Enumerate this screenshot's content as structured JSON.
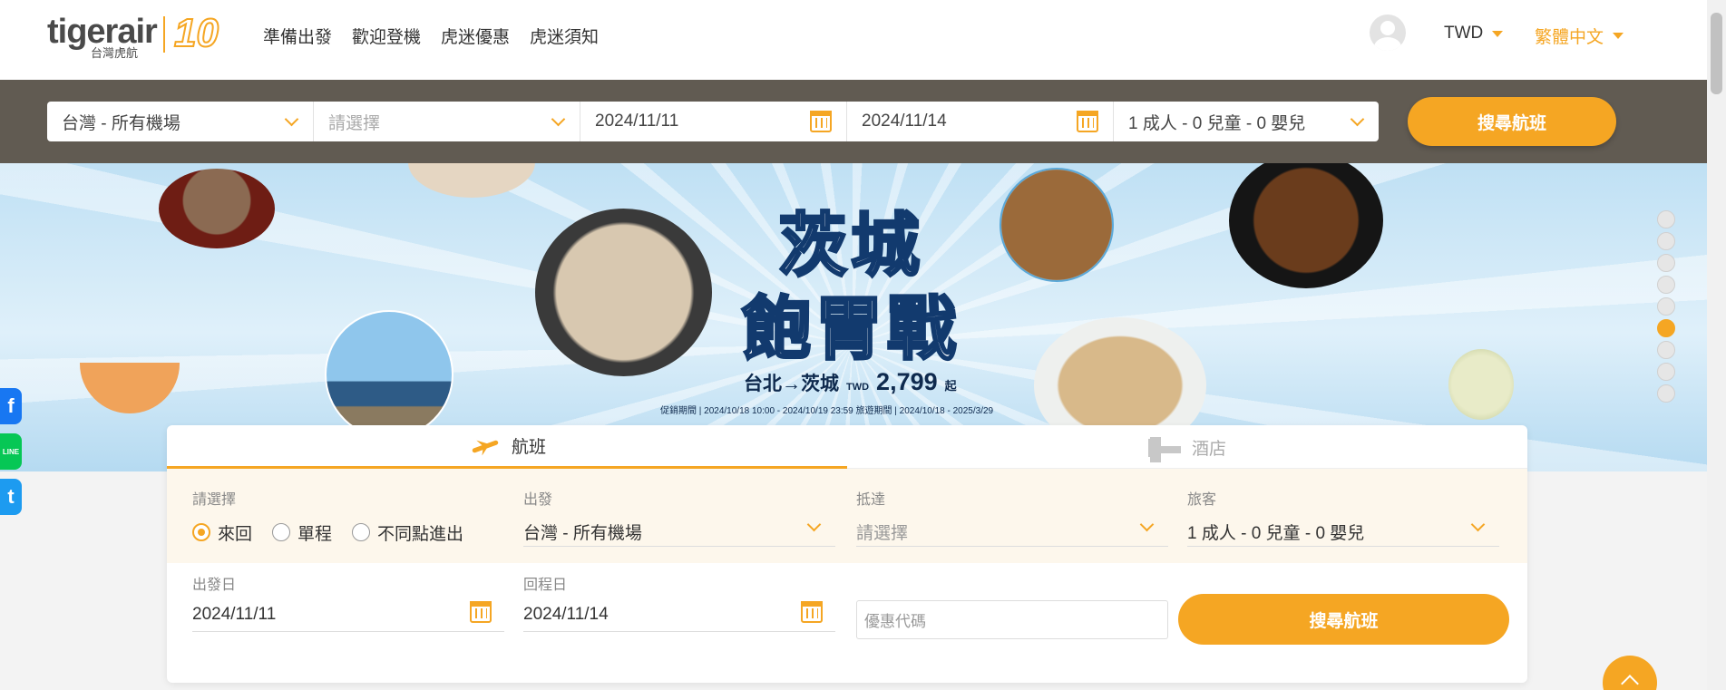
{
  "brand": {
    "name": "tigerair",
    "sub": "台灣虎航",
    "anniversary": "10"
  },
  "nav": {
    "items": [
      "準備出發",
      "歡迎登機",
      "虎迷優惠",
      "虎迷須知"
    ]
  },
  "header": {
    "currency": "TWD",
    "language": "繁體中文"
  },
  "quick_search": {
    "origin": "台灣 - 所有機場",
    "destination_placeholder": "請選擇",
    "depart_date": "2024/11/11",
    "return_date": "2024/11/14",
    "passengers": "1 成人 - 0 兒童 - 0 嬰兒",
    "search_label": "搜尋航班"
  },
  "banner": {
    "title_line1": "茨城",
    "title_line2": "飽胃戰",
    "route": "台北→茨城",
    "currency": "TWD",
    "price": "2,799",
    "price_suffix": "起",
    "fine_print": "促銷期間 | 2024/10/18 10:00 - 2024/10/19 23:59     旅遊期間 | 2024/10/18 - 2025/3/29",
    "slide_count": 9,
    "active_slide": 6
  },
  "social": {
    "facebook": "f",
    "line": "LINE",
    "twitter": "t"
  },
  "booking": {
    "tabs": [
      {
        "label": "航班"
      },
      {
        "label": "酒店"
      }
    ],
    "trip_type_label": "請選擇",
    "trip_types": [
      "來回",
      "單程",
      "不同點進出"
    ],
    "origin_label": "出發",
    "origin_value": "台灣 - 所有機場",
    "destination_label": "抵達",
    "destination_placeholder": "請選擇",
    "passengers_label": "旅客",
    "passengers_value": "1 成人 - 0 兒童 - 0 嬰兒",
    "depart_label": "出發日",
    "depart_value": "2024/11/11",
    "return_label": "回程日",
    "return_value": "2024/11/14",
    "promo_placeholder": "優惠代碼",
    "search_label": "搜尋航班"
  },
  "colors": {
    "accent": "#f5a623",
    "strip": "#615b52"
  }
}
